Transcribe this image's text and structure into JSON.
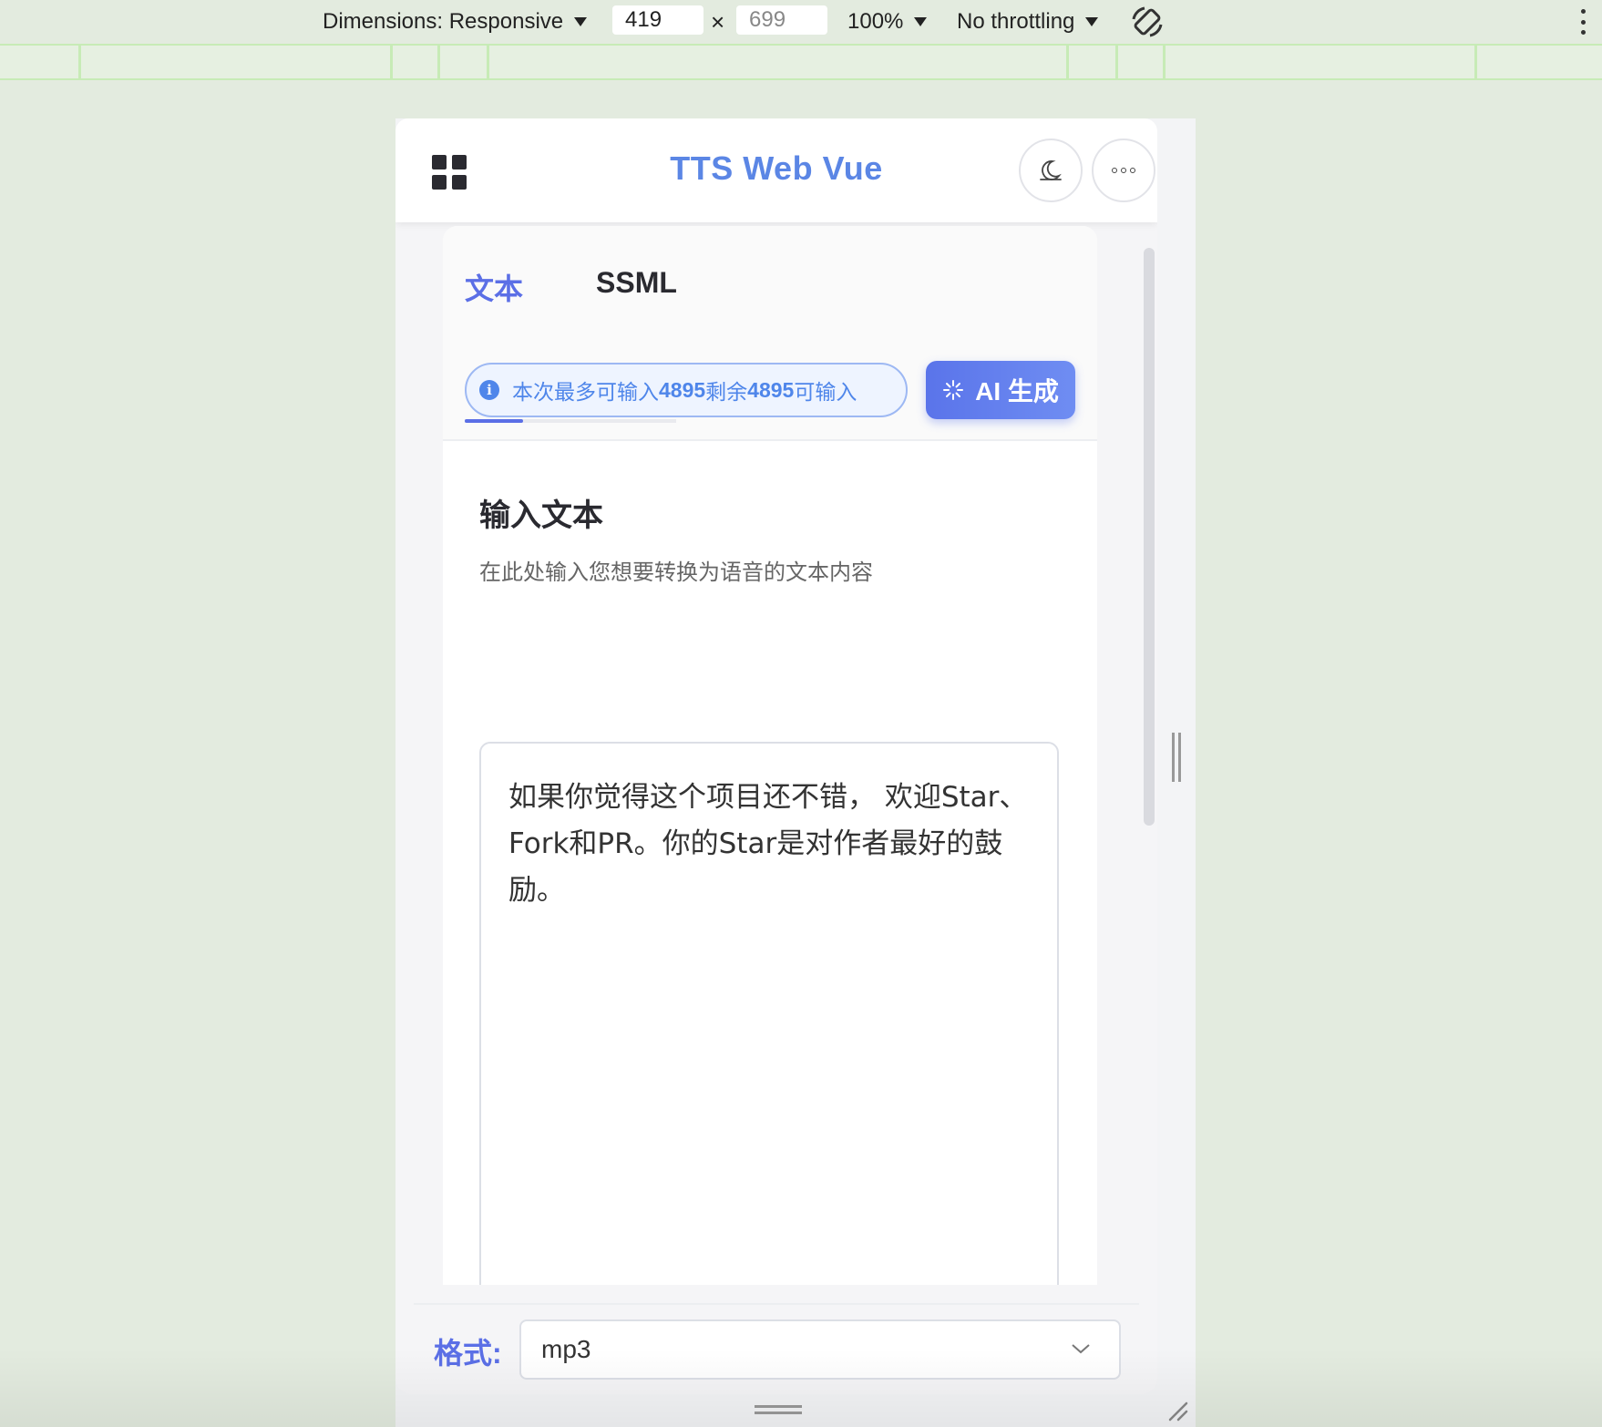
{
  "devtools": {
    "dimensions_label": "Dimensions: Responsive",
    "width_value": "419",
    "height_placeholder": "699",
    "times_symbol": "×",
    "zoom": "100%",
    "throttling": "No throttling"
  },
  "app": {
    "title": "TTS Web Vue",
    "tabs": [
      {
        "label": "文本",
        "active": true
      },
      {
        "label": "SSML",
        "active": false
      }
    ],
    "info_pill": {
      "prefix": "本次最多可输入 ",
      "max": "4895",
      "middle": " 剩余 ",
      "remaining": "4895",
      "suffix": " 可输入"
    },
    "ai_button_label": "AI 生成",
    "section_title": "输入文本",
    "section_desc": "在此处输入您想要转换为语音的文本内容",
    "text_value": "如果你觉得这个项目还不错， 欢迎Star、Fork和PR。你的Star是对作者最好的鼓励。",
    "format_label": "格式:",
    "format_value": "mp3"
  },
  "colors": {
    "accent": "#5b6fe6",
    "title_blue": "#5b86e5",
    "info_blue": "#4f86ea",
    "background": "#e3ebdf"
  }
}
